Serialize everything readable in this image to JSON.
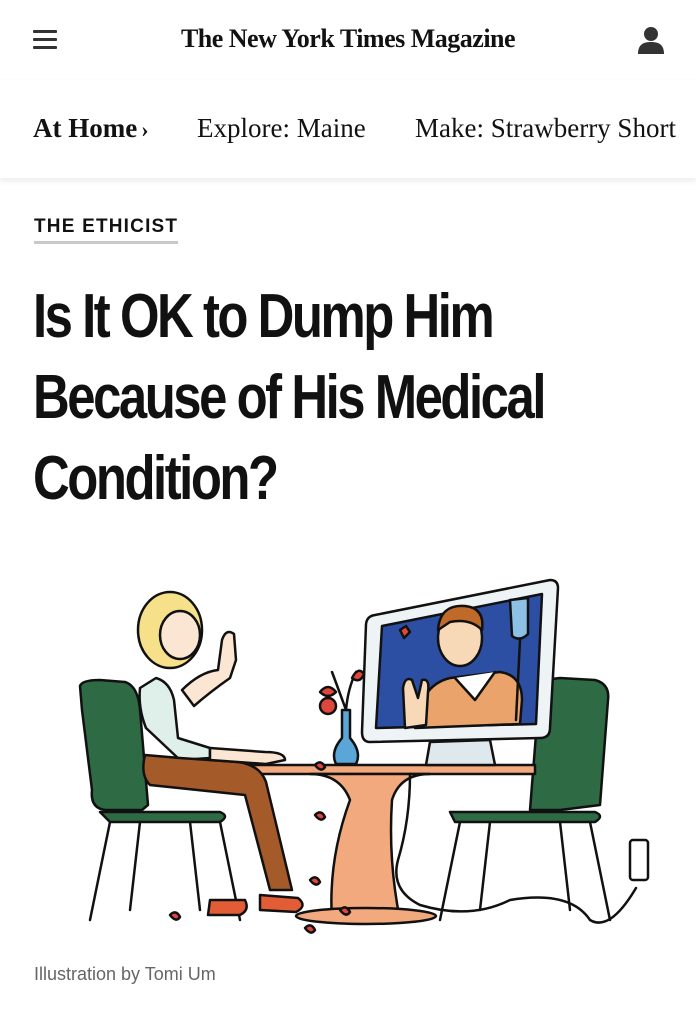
{
  "header": {
    "logo": "The New York Times Magazine",
    "menu_icon": "hamburger-menu-icon",
    "account_icon": "person-icon"
  },
  "subnav": {
    "items": [
      {
        "label": "At Home",
        "active": true,
        "chevron": "›"
      },
      {
        "label": "Explore: Maine"
      },
      {
        "label": "Make: Strawberry Short"
      }
    ]
  },
  "article": {
    "kicker": "THE ETHICIST",
    "headline_lines": [
      "Is It OK to Dump Him",
      "Because of His Medical",
      "Condition?"
    ],
    "illustration": {
      "subject": "woman on video call with man on computer screen at table",
      "colors": {
        "chair": "#2e6b45",
        "table": "#f2a97e",
        "screen": "#2d4fa3",
        "vase": "#5aa6d8",
        "flowers": "#e0473c",
        "pants": "#a55a2a",
        "shoes": "#e25c35",
        "top": "#dff0ea",
        "hair": "#f6e08a"
      }
    },
    "credit": "Illustration by Tomi Um"
  }
}
